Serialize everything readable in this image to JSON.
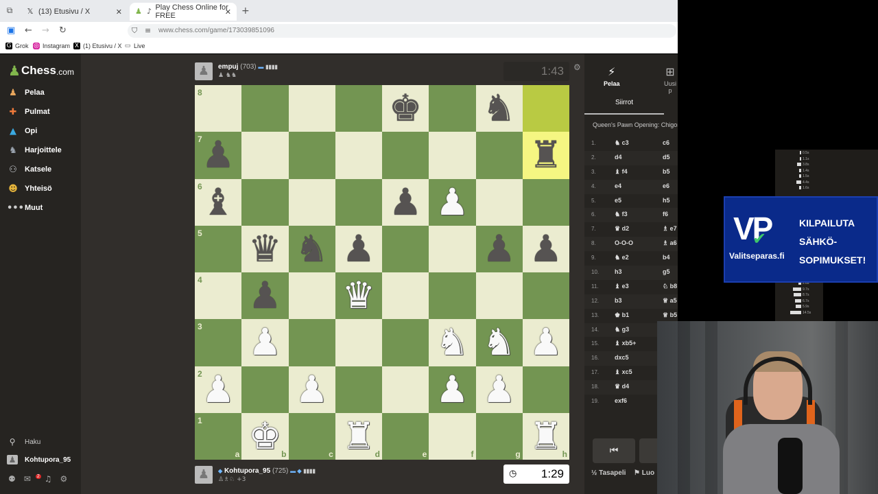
{
  "browser": {
    "tabs": [
      {
        "label": "(13) Etusivu / X",
        "icon": "x-icon"
      },
      {
        "label": "Play Chess Online for FREE",
        "icon": "chess-icon"
      }
    ],
    "url": "www.chess.com/game/173039851096",
    "bookmarks": [
      "Grok",
      "Instagram",
      "(1) Etusivu / X",
      "Live"
    ]
  },
  "sidebar": {
    "logo": "Chess",
    "logo_suffix": ".com",
    "items": [
      {
        "label": "Pelaa",
        "icon": "play-icon"
      },
      {
        "label": "Pulmat",
        "icon": "puzzle-icon"
      },
      {
        "label": "Opi",
        "icon": "learn-icon"
      },
      {
        "label": "Harjoittele",
        "icon": "practice-icon"
      },
      {
        "label": "Katsele",
        "icon": "watch-icon"
      },
      {
        "label": "Yhteisö",
        "icon": "community-icon"
      },
      {
        "label": "Muut",
        "icon": "more-icon"
      }
    ],
    "search_label": "Haku",
    "username": "Kohtupora_95",
    "notifications": "2"
  },
  "game": {
    "top_player": {
      "name": "empuj",
      "rating": "(703)",
      "clock": "1:43"
    },
    "bottom_player": {
      "name": "Kohtupora_95",
      "rating": "(725)",
      "clock": "1:29",
      "captured_extra": "+3"
    },
    "files": [
      "a",
      "b",
      "c",
      "d",
      "e",
      "f",
      "g",
      "h"
    ],
    "ranks": [
      "8",
      "7",
      "6",
      "5",
      "4",
      "3",
      "2",
      "1"
    ],
    "highlight": [
      "h8",
      "h7"
    ],
    "pieces": [
      {
        "sq": "e8",
        "p": "K",
        "c": "b"
      },
      {
        "sq": "g8",
        "p": "N",
        "c": "b"
      },
      {
        "sq": "a7",
        "p": "P",
        "c": "b"
      },
      {
        "sq": "h7",
        "p": "R",
        "c": "b"
      },
      {
        "sq": "a6",
        "p": "B",
        "c": "b"
      },
      {
        "sq": "e6",
        "p": "P",
        "c": "b"
      },
      {
        "sq": "f6",
        "p": "P",
        "c": "w"
      },
      {
        "sq": "b5",
        "p": "Q",
        "c": "b"
      },
      {
        "sq": "c5",
        "p": "N",
        "c": "b"
      },
      {
        "sq": "d5",
        "p": "P",
        "c": "b"
      },
      {
        "sq": "g5",
        "p": "P",
        "c": "b"
      },
      {
        "sq": "h5",
        "p": "P",
        "c": "b"
      },
      {
        "sq": "b4",
        "p": "P",
        "c": "b"
      },
      {
        "sq": "d4",
        "p": "Q",
        "c": "w"
      },
      {
        "sq": "b3",
        "p": "P",
        "c": "w"
      },
      {
        "sq": "f3",
        "p": "N",
        "c": "w"
      },
      {
        "sq": "g3",
        "p": "N",
        "c": "w"
      },
      {
        "sq": "h3",
        "p": "P",
        "c": "w"
      },
      {
        "sq": "a2",
        "p": "P",
        "c": "w"
      },
      {
        "sq": "c2",
        "p": "P",
        "c": "w"
      },
      {
        "sq": "f2",
        "p": "P",
        "c": "w"
      },
      {
        "sq": "g2",
        "p": "P",
        "c": "w"
      },
      {
        "sq": "b1",
        "p": "K",
        "c": "w"
      },
      {
        "sq": "d1",
        "p": "R",
        "c": "w"
      },
      {
        "sq": "h1",
        "p": "R",
        "c": "w"
      }
    ]
  },
  "right_panel": {
    "tab_play": "Pelaa",
    "tab_new": "Uusi p",
    "subtab": "Siirrot",
    "opening": "Queen's Pawn Opening: Chigor",
    "moves": [
      {
        "n": "1.",
        "w": "♞ c3",
        "b": "c6"
      },
      {
        "n": "2.",
        "w": "d4",
        "b": "d5"
      },
      {
        "n": "3.",
        "w": "♝ f4",
        "b": "b5"
      },
      {
        "n": "4.",
        "w": "e4",
        "b": "e6"
      },
      {
        "n": "5.",
        "w": "e5",
        "b": "h5"
      },
      {
        "n": "6.",
        "w": "♞ f3",
        "b": "f6"
      },
      {
        "n": "7.",
        "w": "♛ d2",
        "b": "♗ e7"
      },
      {
        "n": "8.",
        "w": "O-O-O",
        "b": "♗ a6"
      },
      {
        "n": "9.",
        "w": "♞ e2",
        "b": "b4"
      },
      {
        "n": "10.",
        "w": "h3",
        "b": "g5"
      },
      {
        "n": "11.",
        "w": "♝ e3",
        "b": "♘ b8"
      },
      {
        "n": "12.",
        "w": "b3",
        "b": "♕ a5"
      },
      {
        "n": "13.",
        "w": "♚ b1",
        "b": "♕ b5"
      },
      {
        "n": "14.",
        "w": "♞ g3",
        "b": ""
      },
      {
        "n": "15.",
        "w": "♝ xb5+",
        "b": ""
      },
      {
        "n": "16.",
        "w": "dxc5",
        "b": ""
      },
      {
        "n": "17.",
        "w": "♝ xc5",
        "b": ""
      },
      {
        "n": "18.",
        "w": "♛ d4",
        "b": ""
      },
      {
        "n": "19.",
        "w": "exf6",
        "b": ""
      }
    ],
    "draw": "½ Tasapeli",
    "resign": "Luo"
  },
  "time_graph": [
    {
      "t": "0.5s",
      "w": 2
    },
    {
      "t": "1.1s",
      "w": 2
    },
    {
      "t": "3.8s",
      "w": 6
    },
    {
      "t": "1.4s",
      "w": 3
    },
    {
      "t": "1.5s",
      "w": 3
    },
    {
      "t": "4.4s",
      "w": 7
    },
    {
      "t": "1.6s",
      "w": 3
    }
  ],
  "time_graph_lower": [
    {
      "t": "2.6s",
      "w": 4
    },
    {
      "t": "9.7s",
      "w": 12
    },
    {
      "t": "8.7s",
      "w": 11
    },
    {
      "t": "6.7s",
      "w": 9
    },
    {
      "t": "5.9s",
      "w": 8
    },
    {
      "t": "14.5s",
      "w": 16
    }
  ],
  "ad": {
    "logo": "VP",
    "site": "Valitseparas.fi",
    "lines": [
      "KILPAILUTA",
      "SÄHKÖ-",
      "SOPIMUKSET!"
    ]
  }
}
